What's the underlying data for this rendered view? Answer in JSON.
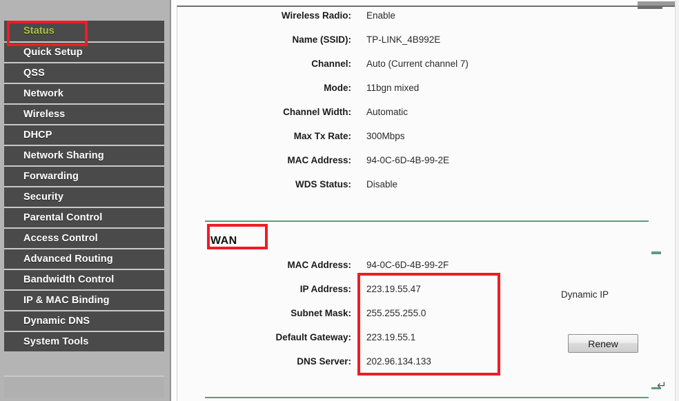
{
  "sidebar": {
    "items": [
      {
        "label": "Status",
        "active": true
      },
      {
        "label": "Quick Setup",
        "active": false
      },
      {
        "label": "QSS",
        "active": false
      },
      {
        "label": "Network",
        "active": false
      },
      {
        "label": "Wireless",
        "active": false
      },
      {
        "label": "DHCP",
        "active": false
      },
      {
        "label": "Network Sharing",
        "active": false
      },
      {
        "label": "Forwarding",
        "active": false
      },
      {
        "label": "Security",
        "active": false
      },
      {
        "label": "Parental Control",
        "active": false
      },
      {
        "label": "Access Control",
        "active": false
      },
      {
        "label": "Advanced Routing",
        "active": false
      },
      {
        "label": "Bandwidth Control",
        "active": false
      },
      {
        "label": "IP & MAC Binding",
        "active": false
      },
      {
        "label": "Dynamic DNS",
        "active": false
      },
      {
        "label": "System Tools",
        "active": false
      }
    ]
  },
  "wireless": {
    "rows": [
      {
        "label": "Wireless Radio:",
        "value": "Enable"
      },
      {
        "label": "Name (SSID):",
        "value": "TP-LINK_4B992E"
      },
      {
        "label": "Channel:",
        "value": "Auto (Current channel 7)"
      },
      {
        "label": "Mode:",
        "value": "11bgn mixed"
      },
      {
        "label": "Channel Width:",
        "value": "Automatic"
      },
      {
        "label": "Max Tx Rate:",
        "value": "300Mbps"
      },
      {
        "label": "MAC Address:",
        "value": "94-0C-6D-4B-99-2E"
      },
      {
        "label": "WDS Status:",
        "value": "Disable"
      }
    ]
  },
  "wan": {
    "heading": "WAN",
    "rows": [
      {
        "label": "MAC Address:",
        "value": "94-0C-6D-4B-99-2F"
      },
      {
        "label": "IP Address:",
        "value": "223.19.55.47"
      },
      {
        "label": "Subnet Mask:",
        "value": "255.255.255.0"
      },
      {
        "label": "Default Gateway:",
        "value": "223.19.55.1"
      },
      {
        "label": "DNS Server:",
        "value": "202.96.134.133"
      }
    ],
    "connection_type": "Dynamic IP",
    "renew_label": "Renew"
  },
  "annotations": {
    "highlight_color": "#ee1c25",
    "boxes": [
      "status-nav-item",
      "wan-section-heading",
      "wan-ip-values"
    ]
  },
  "document_marks": {
    "paragraph_mark": "↵"
  },
  "colors": {
    "nav_background": "#4a4a4a",
    "nav_active_text": "#a8c23c",
    "divider_green": "#5c9c78"
  }
}
